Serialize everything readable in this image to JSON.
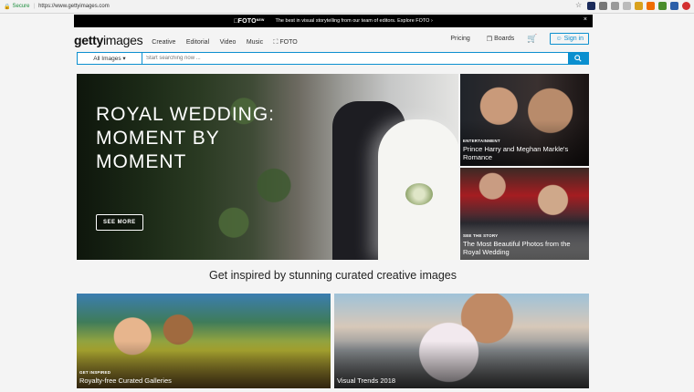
{
  "browser": {
    "secure_label": "Secure",
    "url": "https://www.gettyimages.com",
    "extension_colors": [
      "#1b2b5b",
      "#777777",
      "#999999",
      "#bbbbbb",
      "#d9a11d",
      "#ef6c00",
      "#4a8c2a",
      "#2b5fa8",
      "#d32f2f"
    ]
  },
  "promo": {
    "logo": "FOTO",
    "logo_sup": "NEW",
    "text": "The best in visual storytelling from our team of editors. Explore FOTO  ›",
    "close": "×"
  },
  "header": {
    "brand_bold": "getty",
    "brand_light": "images",
    "nav": [
      "Creative",
      "Editorial",
      "Video",
      "Music",
      "FOTO"
    ],
    "pricing": "Pricing",
    "boards": "Boards",
    "signin": "Sign in"
  },
  "search": {
    "scope": "All Images ▾",
    "placeholder": "Start searching now ..."
  },
  "hero": {
    "title": "ROYAL WEDDING: MOMENT BY MOMENT",
    "cta": "SEE MORE"
  },
  "side_cards": [
    {
      "kicker": "ENTERTAINMENT",
      "title": "Prince Harry and Meghan Markle's Romance"
    },
    {
      "kicker": "SEE THE STORY",
      "title": "The Most Beautiful Photos from the Royal Wedding"
    }
  ],
  "section_title": "Get inspired by stunning curated creative images",
  "bottom_cards": [
    {
      "kicker": "GET INSPIRED",
      "title": "Royalty-free Curated Galleries"
    },
    {
      "kicker": "",
      "title": "Visual Trends 2018"
    }
  ],
  "colors": {
    "accent": "#0b8fcf",
    "promo_bg": "#000000"
  }
}
